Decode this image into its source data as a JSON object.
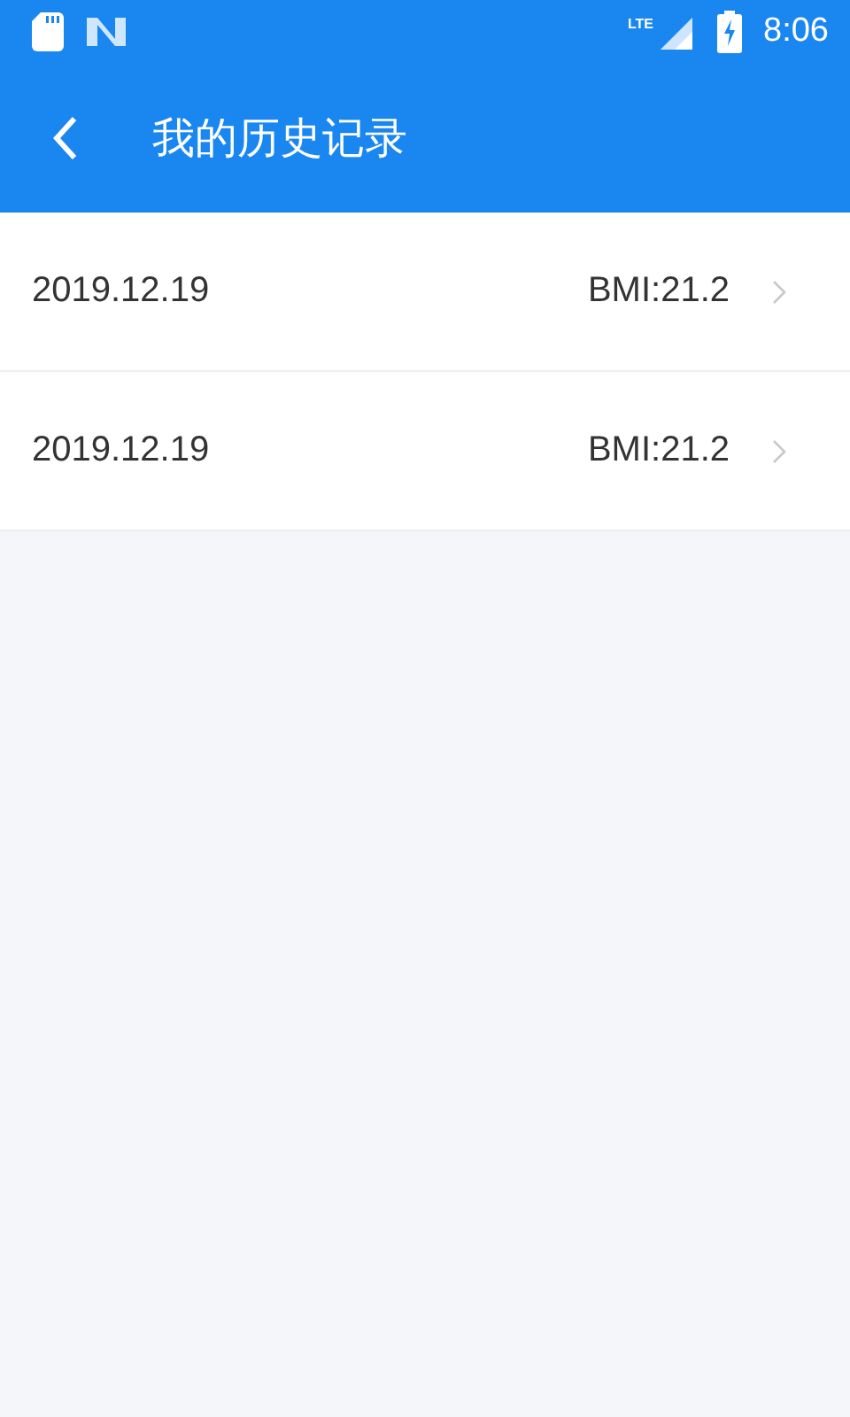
{
  "status_bar": {
    "network": "LTE",
    "time": "8:06"
  },
  "app_bar": {
    "title": "我的历史记录"
  },
  "records": [
    {
      "date": "2019.12.19",
      "bmi": "BMI:21.2"
    },
    {
      "date": "2019.12.19",
      "bmi": "BMI:21.2"
    }
  ]
}
